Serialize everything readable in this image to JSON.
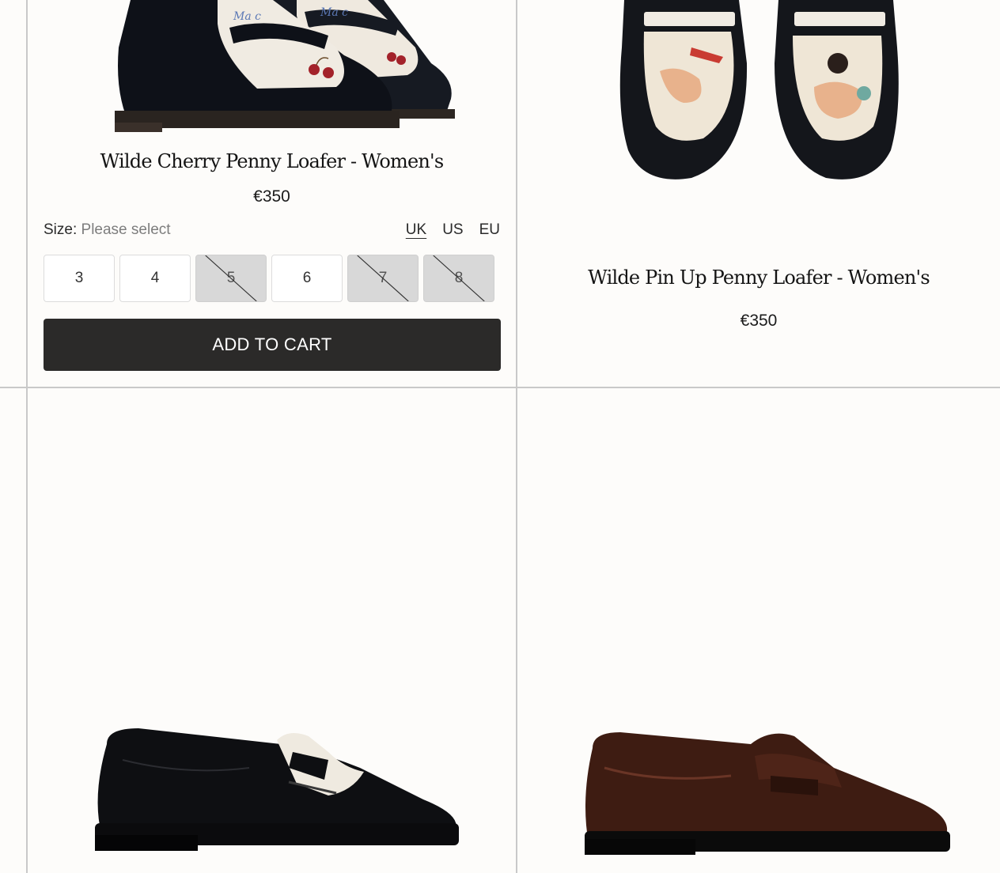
{
  "products": [
    {
      "title": "Wilde Cherry Penny Loafer - Women's",
      "price": "€350",
      "size_label": "Size:",
      "size_placeholder": "Please select",
      "units": [
        "UK",
        "US",
        "EU"
      ],
      "active_unit": "UK",
      "sizes": [
        {
          "label": "3",
          "available": true
        },
        {
          "label": "4",
          "available": true
        },
        {
          "label": "5",
          "available": false
        },
        {
          "label": "6",
          "available": true
        },
        {
          "label": "7",
          "available": false
        },
        {
          "label": "8",
          "available": false
        }
      ],
      "add_to_cart": "ADD TO CART"
    },
    {
      "title": "Wilde Pin Up Penny Loafer - Women's",
      "price": "€350"
    }
  ]
}
